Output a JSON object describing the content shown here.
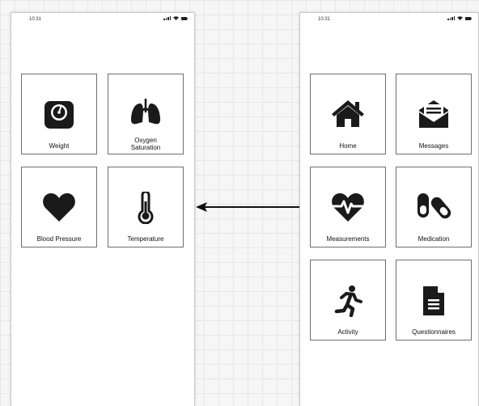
{
  "left_screen": {
    "status_time": "10:31",
    "tiles": [
      {
        "label": "Weight",
        "icon": "scale-icon"
      },
      {
        "label_line1": "Oxygen",
        "label_line2": "Saturation",
        "icon": "lungs-icon"
      },
      {
        "label": "Blood Pressure",
        "icon": "heart-icon"
      },
      {
        "label": "Temperature",
        "icon": "thermometer-icon"
      }
    ]
  },
  "right_screen": {
    "status_time": "10:31",
    "tiles": [
      {
        "label": "Home",
        "icon": "home-icon"
      },
      {
        "label": "Messages",
        "icon": "envelope-icon"
      },
      {
        "label": "Measurements",
        "icon": "heartbeat-icon"
      },
      {
        "label": "Medication",
        "icon": "pills-icon"
      },
      {
        "label": "Activity",
        "icon": "running-icon"
      },
      {
        "label": "Questionnaires",
        "icon": "document-icon"
      }
    ]
  },
  "colors": {
    "icon": "#1a1a1a",
    "tile_border": "#6f6f6f",
    "canvas_bg": "#f6f6f6"
  }
}
